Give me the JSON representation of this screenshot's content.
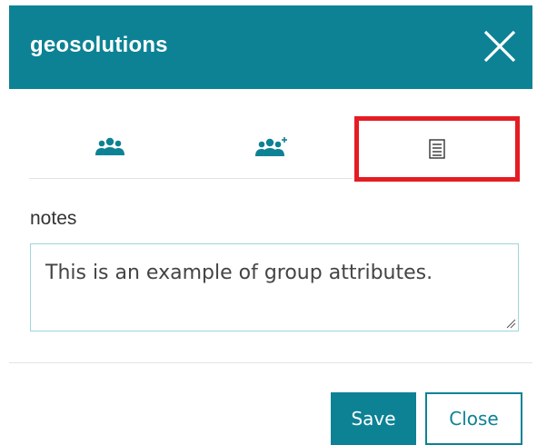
{
  "dialog": {
    "title": "geosolutions",
    "close_icon": "close-icon"
  },
  "tabs": [
    {
      "icon": "group-icon",
      "active": false
    },
    {
      "icon": "group-add-icon",
      "active": false
    },
    {
      "icon": "list-attributes-icon",
      "active": true,
      "highlighted": true
    }
  ],
  "attributes": {
    "notes_label": "notes",
    "notes_value": "This is an example of group attributes."
  },
  "footer": {
    "save_label": "Save",
    "close_label": "Close"
  },
  "colors": {
    "primary": "#0d8295",
    "highlight": "#e51c23",
    "header_text": "#ffffff"
  }
}
